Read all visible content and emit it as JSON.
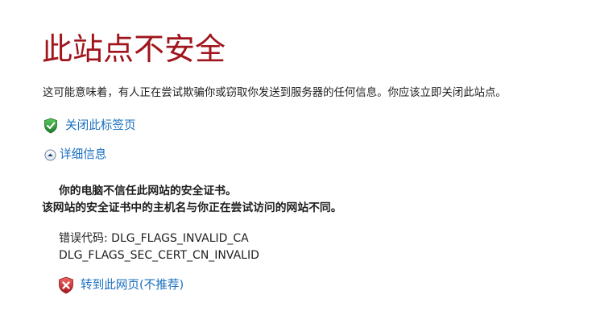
{
  "page": {
    "title": "此站点不安全",
    "warning": "这可能意味着，有人正在尝试欺骗你或窃取你发送到服务器的任何信息。你应该立即关闭此站点。",
    "close_tab_label": "关闭此标签页",
    "details_label": "详细信息",
    "details": {
      "line1": "你的电脑不信任此网站的安全证书。",
      "line2": "该网站的安全证书中的主机名与你正在尝试访问的网站不同。"
    },
    "error_code": {
      "line1": "错误代码: DLG_FLAGS_INVALID_CA",
      "line2": "DLG_FLAGS_SEC_CERT_CN_INVALID"
    },
    "proceed_label": "转到此网页(不推荐)"
  },
  "icons": {
    "close_tab": "green-shield-check-icon",
    "details": "chevron-up-circle-icon",
    "proceed": "red-shield-x-icon"
  },
  "colors": {
    "title": "#a0141c",
    "link": "#1a6fbf",
    "text": "#1f1f1f",
    "safe_green": "#2e9e3a",
    "danger_red": "#c8202a"
  }
}
